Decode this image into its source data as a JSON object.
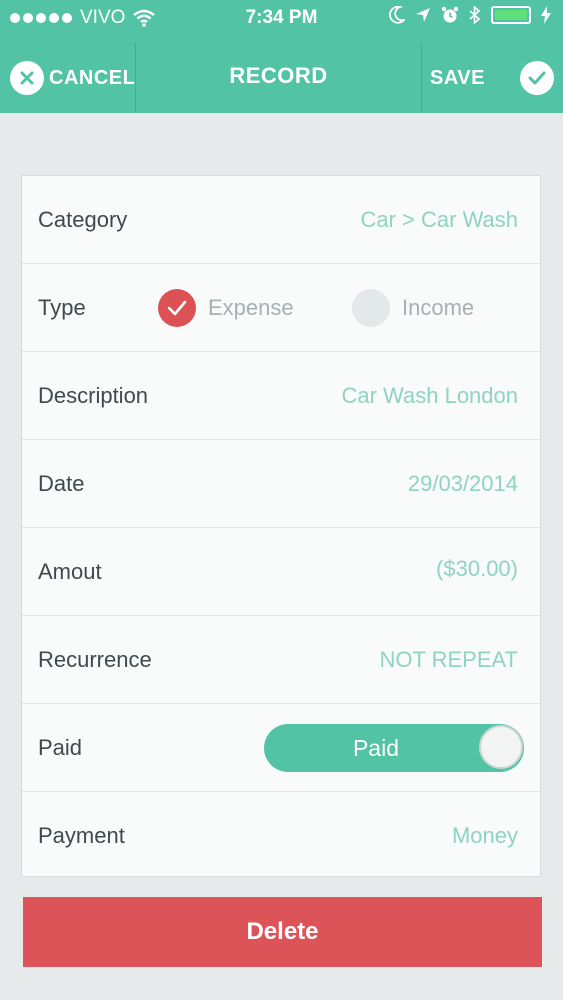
{
  "status": {
    "carrier": "VIVO",
    "time": "7:34 PM",
    "battery_level": 1.0
  },
  "nav": {
    "cancel_label": "CANCEL",
    "title": "RECORD",
    "save_label": "SAVE"
  },
  "form": {
    "category": {
      "label": "Category",
      "value": "Car > Car Wash"
    },
    "type": {
      "label": "Type",
      "option_expense": "Expense",
      "option_income": "Income",
      "selected": "Expense"
    },
    "description": {
      "label": "Description",
      "value": "Car Wash London"
    },
    "date": {
      "label": "Date",
      "value": "29/03/2014"
    },
    "amount": {
      "label": "Amout",
      "value": "($30.00)"
    },
    "recurrence": {
      "label": "Recurrence",
      "value": "NOT REPEAT"
    },
    "paid": {
      "label": "Paid",
      "toggle_text": "Paid",
      "on": true
    },
    "payment": {
      "label": "Payment",
      "value": "Money"
    }
  },
  "delete_label": "Delete",
  "colors": {
    "accent": "#52c3a4",
    "danger": "#dc5457",
    "value_text": "#8fd3c1"
  },
  "icons": [
    "signal-dots-icon",
    "wifi-icon",
    "moon-icon",
    "location-arrow-icon",
    "alarm-icon",
    "bluetooth-icon",
    "battery-icon",
    "charging-icon",
    "close-circle-icon",
    "check-circle-icon",
    "checkmark-icon"
  ]
}
